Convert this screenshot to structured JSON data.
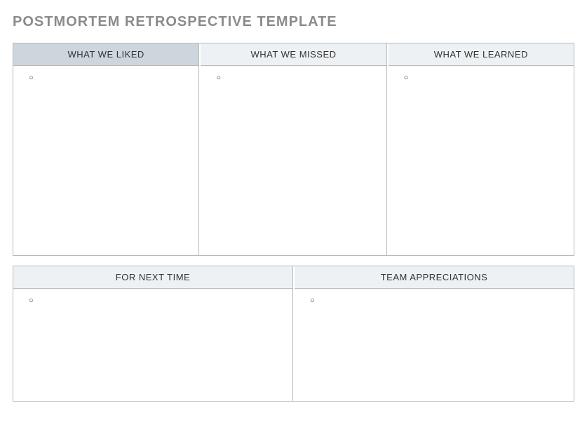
{
  "title": "POSTMORTEM RETROSPECTIVE TEMPLATE",
  "top_row": {
    "cols": [
      {
        "header": "WHAT WE LIKED",
        "highlight": true,
        "bullet": "○"
      },
      {
        "header": "WHAT WE MISSED",
        "highlight": false,
        "bullet": "○"
      },
      {
        "header": "WHAT WE LEARNED",
        "highlight": false,
        "bullet": "○"
      }
    ]
  },
  "bottom_row": {
    "cols": [
      {
        "header": "FOR NEXT TIME",
        "highlight": false,
        "bullet": "○"
      },
      {
        "header": "TEAM APPRECIATIONS",
        "highlight": false,
        "bullet": "○"
      }
    ]
  }
}
